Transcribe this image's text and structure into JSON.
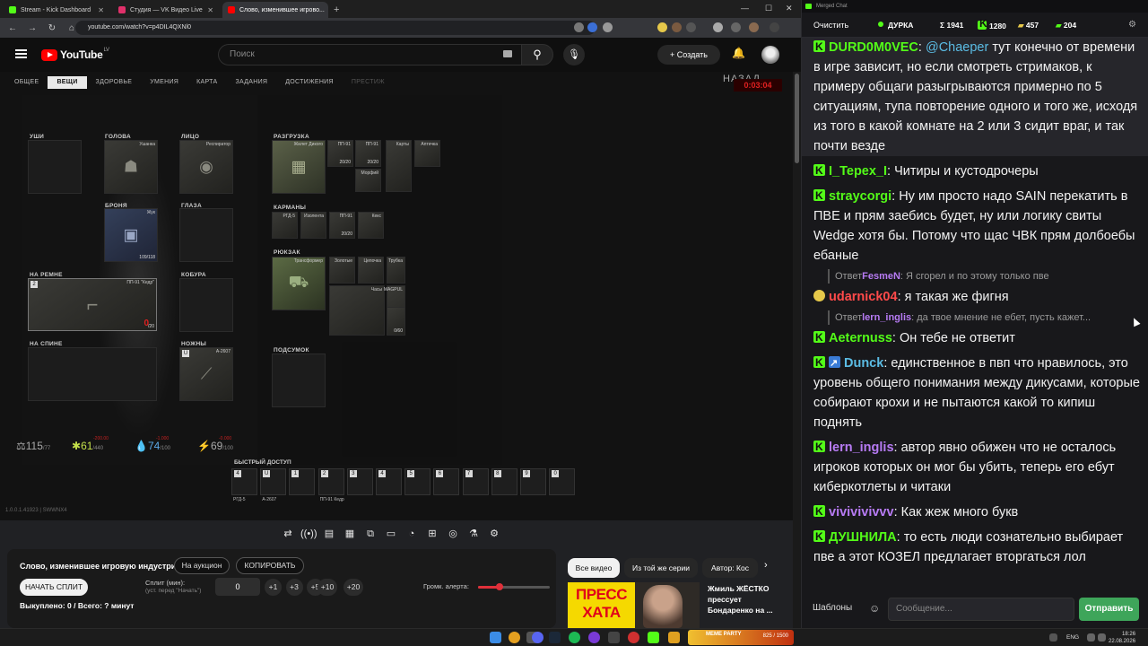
{
  "browser": {
    "tabs": [
      {
        "title": "Stream - Kick Dashboard",
        "color": "#53fc18",
        "active": false
      },
      {
        "title": "Студия — VK Видео Live",
        "color": "#e0306a",
        "active": false
      },
      {
        "title": "Слово, изменившее игрово...",
        "color": "#ff0000",
        "active": true
      }
    ],
    "newtab": "+",
    "url": "youtube.com/watch?v=p4DIL4QXNl0",
    "nav": {
      "back": "←",
      "forward": "→",
      "reload": "↻",
      "home": "⌂"
    }
  },
  "youtube": {
    "logo": "YouTube",
    "region": "LV",
    "search_placeholder": "Поиск",
    "create_label": "Создать",
    "create_icon": "+"
  },
  "game": {
    "tabs": [
      "ОБЩЕЕ",
      "ВЕЩИ",
      "ЗДОРОВЬЕ",
      "УМЕНИЯ",
      "КАРТА",
      "ЗАДАНИЯ",
      "ДОСТИЖЕНИЯ",
      "ПРЕСТИЖ"
    ],
    "back": "НАЗАД",
    "timer": "0:03:04",
    "slots": {
      "ears": "УШИ",
      "head": "ГОЛОВА",
      "head_item": "Ушанка",
      "face": "ЛИЦО",
      "face_item": "Респиратор",
      "armor": "БРОНЯ",
      "armor_item": "Жук",
      "armor_dur": "109/118",
      "eyes": "ГЛАЗА",
      "belt": "НА РЕМНЕ",
      "belt_item": "ПП-91 \"Кедр\"",
      "belt_ammo": "/20",
      "belt_ammo_cur": "0",
      "belt_num": "2",
      "holster": "КОБУРА",
      "back": "НА СПИНЕ",
      "knife": "НОЖНЫ",
      "knife_item": "А-2607",
      "knife_num": "U",
      "rig": "РАЗГРУЗКА",
      "rig_item": "Жилет Дикого",
      "pockets": "КАРМАНЫ",
      "backpack": "РЮКЗАК",
      "backpack_item": "Трансформер",
      "pouch": "ПОДСУМОК"
    },
    "rig_items": [
      {
        "name": "ПП-91",
        "count": "20/20"
      },
      {
        "name": "ПП-91",
        "count": "20/20"
      },
      {
        "name": "Морфий",
        "count": ""
      },
      {
        "name": "Карты",
        "count": ""
      },
      {
        "name": "Аптечка",
        "count": ""
      }
    ],
    "pocket_items": [
      {
        "name": "РГД-5",
        "count": ""
      },
      {
        "name": "Изолента",
        "count": ""
      },
      {
        "name": "ПП-91",
        "count": "20/20"
      },
      {
        "name": "Кекс",
        "count": ""
      }
    ],
    "backpack_items": [
      {
        "name": "Золотые",
        "count": ""
      },
      {
        "name": "Цепочка",
        "count": ""
      },
      {
        "name": "Трубка",
        "count": ""
      },
      {
        "name": "Часы",
        "count": ""
      },
      {
        "name": "MAGPUL",
        "count": ""
      },
      {
        "name": "",
        "count": "0/60"
      }
    ],
    "stats": [
      {
        "icon": "⚖",
        "value": "115",
        "max": "/77",
        "dmg": ""
      },
      {
        "icon": "✱",
        "value": "61",
        "max": "/440",
        "dmg": "-200.00",
        "color": "#c4e04a"
      },
      {
        "icon": "💧",
        "value": "74",
        "max": "/100",
        "dmg": "-1.000",
        "color": "#5aa8e6"
      },
      {
        "icon": "⚡",
        "value": "69",
        "max": "/100",
        "dmg": "-0.000",
        "color": "#aaaaaa"
      }
    ],
    "quickbar_label": "БЫСТРЫЙ ДОСТУП",
    "quickbar": [
      {
        "n": "4",
        "label": "РГД-5"
      },
      {
        "n": "U",
        "label": "А-2607"
      },
      {
        "n": "1",
        "label": ""
      },
      {
        "n": "2",
        "label": "ПП-91 Кедр"
      },
      {
        "n": "3",
        "label": ""
      },
      {
        "n": "4",
        "label": ""
      },
      {
        "n": "5",
        "label": ""
      },
      {
        "n": "6",
        "label": ""
      },
      {
        "n": "7",
        "label": ""
      },
      {
        "n": "8",
        "label": ""
      },
      {
        "n": "9",
        "label": ""
      },
      {
        "n": "0",
        "label": ""
      }
    ],
    "version": "1.0.0.1.41923 | SWWNX4"
  },
  "controls": [
    "⇄",
    "((•))",
    "▤",
    "▦",
    "⧉",
    "▭",
    "◔",
    "⊞",
    "◎",
    "⚗",
    "⚙"
  ],
  "stream_panel": {
    "title": "Слово, изменившее игровую индустрию",
    "auction": "На аукцион",
    "copy": "КОПИРОВАТЬ",
    "start_split": "НАЧАТЬ СПЛИТ",
    "split_label": "Сплит (мин):",
    "split_hint": "(уст. перед \"Начать\")",
    "split_value": "0",
    "increments": [
      "+1",
      "+3",
      "+5",
      "+10",
      "+20"
    ],
    "alert_label": "Громк. алерта:",
    "alert_volume": 0.3,
    "progress": "Выкуплено: 0 / Всего: ? минут"
  },
  "recommendations": {
    "chips": [
      "Все видео",
      "Из той же серии",
      "Автор: Кос"
    ],
    "thumb_text": "ПРЕСС ХАТА",
    "title": "Жмиль ЖЁСТКО прессует Бондаренко на ..."
  },
  "taskbar": {
    "game_label": "MEME PARTY",
    "game_count": "825 / 1500",
    "lang": "ENG",
    "time": "18:26",
    "date": "22.08.2026"
  },
  "chat": {
    "window_title": "Merged Chat",
    "clear": "Очистить",
    "channel": "ДУРКА",
    "sigma": "Σ 1941",
    "kick_count": "1280",
    "viewers_a": "457",
    "viewers_b": "204",
    "messages": [
      {
        "user": "DURD0M0VEC",
        "color": "#53fc18",
        "badge": "kick",
        "mention": "@Chaeper",
        "text": " тут конечно от времени в игре зависит, но если смотреть стримаков, к примеру общаги разыгрываются примерно по 5 ситуациям, тупа повторение одного и того же, исходя из того в какой комнате на 2 или 3 сидит враг, и так почти везде",
        "highlight": true
      },
      {
        "user": "I_Tepex_I",
        "color": "#53fc18",
        "badge": "kick",
        "text": "Читиры и кустодрочеры"
      },
      {
        "user": "straycorgi",
        "color": "#53fc18",
        "badge": "kick",
        "text": "Ну им просто надо SAIN перекатить в ПВЕ и прям заебись будет, ну или логику свиты Wedge хотя бы. Потому что щас ЧВК прям долбоебы ебаные"
      },
      {
        "reply_user": "FesmeN",
        "reply_text": "Я сгорел и по этому только пве",
        "reply_prefix": "Ответ"
      },
      {
        "user": "udarnick04",
        "color": "#ff4a4a",
        "badge": "smile",
        "text": "я такая же фигня"
      },
      {
        "reply_user": "lern_inglis",
        "reply_text": "да твое мнение не ебет, пусть кажет...",
        "reply_prefix": "Ответ"
      },
      {
        "user": "Aeternuss",
        "color": "#53fc18",
        "badge": "kick",
        "text": "Он тебе не ответит"
      },
      {
        "user": "Dunck",
        "color": "#5bbce4",
        "badge": "kick+blue",
        "text": "единственное в пвп что нравилось, это уровень общего понимания между дикусами, которые собирают крохи и не пытаются какой то кипиш поднять"
      },
      {
        "user": "lern_inglis",
        "color": "#b77bf4",
        "badge": "kick",
        "text": "автор явно обижен что не осталось игроков которых он мог бы убить, теперь его ебут киберкотлеты и читаки"
      },
      {
        "user": "vivivivivvv",
        "color": "#b77bf4",
        "badge": "kick",
        "text": "Как жеж много букв"
      },
      {
        "user": "ДУШНИЛА",
        "color": "#53fc18",
        "badge": "kick",
        "text": "то есть люди сознательно выбирает пве а этот КОЗЕЛ предлагает вторгаться лол"
      }
    ],
    "templates": "Шаблоны",
    "input_placeholder": "Сообщение...",
    "send": "Отправить"
  }
}
